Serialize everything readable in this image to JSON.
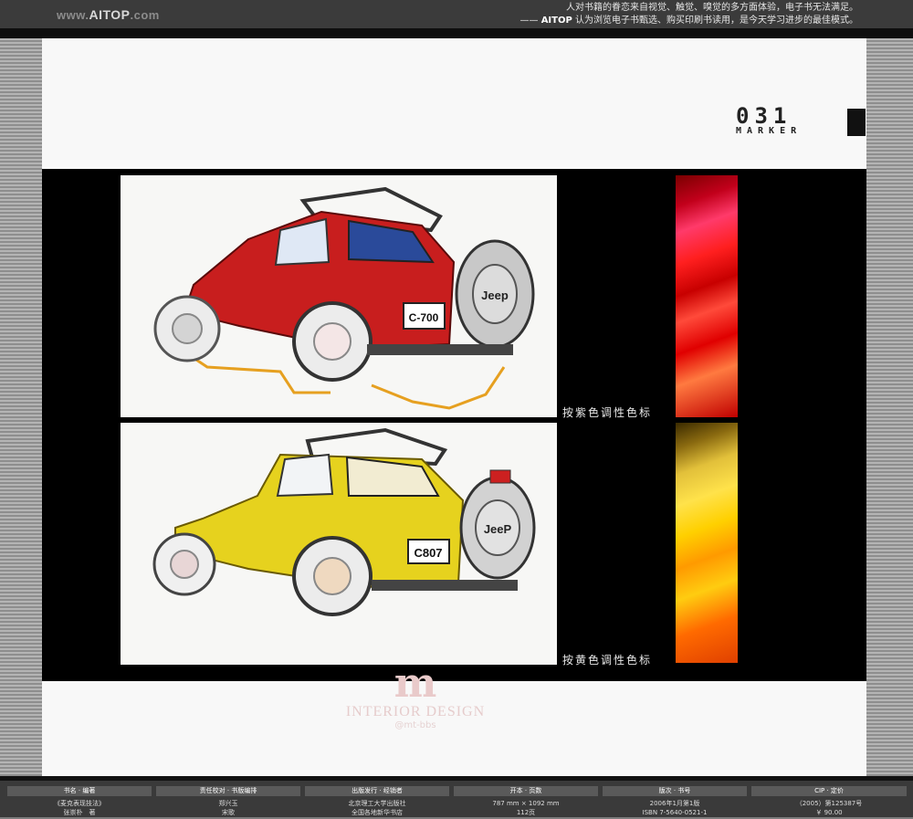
{
  "header": {
    "logo_prefix": "www.",
    "logo_brand": "AITOP",
    "logo_suffix": ".com",
    "slogan_line1": "人对书籍的眷恋来自视觉、触觉、嗅觉的多方面体验，电子书无法满足。",
    "slogan_line2_prefix": "—— ",
    "slogan_line2_brand": "AITOP",
    "slogan_line2_rest": " 认为浏览电子书甄选、购买印刷书读用，是今天学习进步的最佳模式。"
  },
  "page": {
    "number": "031",
    "label": "MARKER",
    "captions": [
      "按紫色调性色标",
      "按黄色调性色标"
    ]
  },
  "watermark": {
    "mark": "m",
    "text": "INTERIOR DESIGN",
    "sub": "@mt-bbs"
  },
  "footer": {
    "columns": [
      {
        "header": "书名 · 编著",
        "lines": [
          "《麦克表现技法》",
          "张崇朴　著"
        ]
      },
      {
        "header": "责任校对 · 书版编排",
        "lines": [
          "郑兴玉",
          "宋歌"
        ]
      },
      {
        "header": "出版发行 · 经销者",
        "lines": [
          "北京理工大学出版社",
          "全国各地新华书店"
        ]
      },
      {
        "header": "开本 · 页数",
        "lines": [
          "787 mm × 1092 mm",
          "112页"
        ]
      },
      {
        "header": "版次 · 书号",
        "lines": [
          "2006年1月第1版",
          "ISBN 7-5640-0521-1"
        ]
      },
      {
        "header": "CIP · 定价",
        "lines": [
          "（2005）第125387号",
          "￥ 90.00"
        ]
      }
    ]
  },
  "colors": {
    "swatch_red": "#d40000",
    "swatch_yellow": "#ffd000",
    "jeep_red": "#c81e1e",
    "jeep_yellow": "#e6d21e"
  }
}
